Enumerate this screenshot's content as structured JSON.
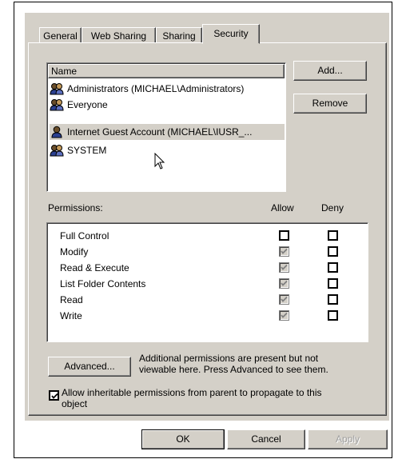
{
  "tabs": [
    {
      "label": "General"
    },
    {
      "label": "Web Sharing"
    },
    {
      "label": "Sharing"
    },
    {
      "label": "Security"
    }
  ],
  "users_list": {
    "column_header": "Name",
    "items": [
      {
        "label": "Administrators (MICHAEL\\Administrators)",
        "icon": "group-users-icon"
      },
      {
        "label": "Everyone",
        "icon": "group-users-icon"
      },
      {
        "label": "Internet Guest Account (MICHAEL\\IUSR_...",
        "icon": "single-user-icon",
        "selected": true
      },
      {
        "label": "SYSTEM",
        "icon": "group-users-icon"
      }
    ]
  },
  "buttons": {
    "add": "Add...",
    "remove": "Remove",
    "advanced": "Advanced...",
    "ok": "OK",
    "cancel": "Cancel",
    "apply": "Apply"
  },
  "permissions": {
    "label": "Permissions:",
    "allow_header": "Allow",
    "deny_header": "Deny",
    "rows": [
      {
        "label": "Full Control",
        "allow": false,
        "allow_disabled": false,
        "deny": false
      },
      {
        "label": "Modify",
        "allow": true,
        "allow_disabled": true,
        "deny": false
      },
      {
        "label": "Read & Execute",
        "allow": true,
        "allow_disabled": true,
        "deny": false
      },
      {
        "label": "List Folder Contents",
        "allow": true,
        "allow_disabled": true,
        "deny": false
      },
      {
        "label": "Read",
        "allow": true,
        "allow_disabled": true,
        "deny": false
      },
      {
        "label": "Write",
        "allow": true,
        "allow_disabled": true,
        "deny": false
      }
    ]
  },
  "advanced_note_line1": "Additional permissions are present but not",
  "advanced_note_line2": "viewable here. Press Advanced to see them.",
  "inherit_checkbox": {
    "checked": true,
    "label_line1": "Allow inheritable permissions from parent to propagate to this",
    "label_line2": "object"
  }
}
